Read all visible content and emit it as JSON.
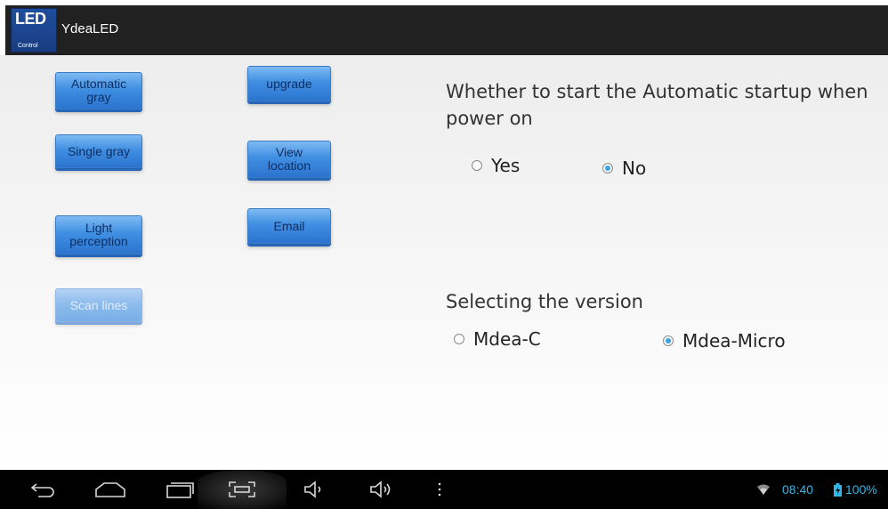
{
  "app": {
    "icon_text_big": "LED",
    "icon_text_small": "Control",
    "title": "YdeaLED"
  },
  "buttons": {
    "automatic_gray": "Automatic\ngray",
    "upgrade": "upgrade",
    "single_gray": "Single gray",
    "view_location": "View\nlocation",
    "light_perception": "Light\nperception",
    "email": "Email",
    "scan_lines": "Scan lines"
  },
  "autostart": {
    "question": "Whether to start the Automatic startup when power on",
    "options": [
      {
        "label": "Yes",
        "selected": false
      },
      {
        "label": "No",
        "selected": true
      }
    ]
  },
  "version": {
    "question": "Selecting the version",
    "options": [
      {
        "label": "Mdea-C",
        "selected": false
      },
      {
        "label": "Mdea-Micro",
        "selected": true
      }
    ]
  },
  "navbar": {
    "icons": [
      "back-icon",
      "home-icon",
      "recent-apps-icon",
      "screenshot-icon",
      "volume-down-icon",
      "volume-up-icon",
      "menu-icon"
    ]
  },
  "status": {
    "time": "08:40",
    "battery": "100%",
    "accent_color": "#33b5e5"
  }
}
